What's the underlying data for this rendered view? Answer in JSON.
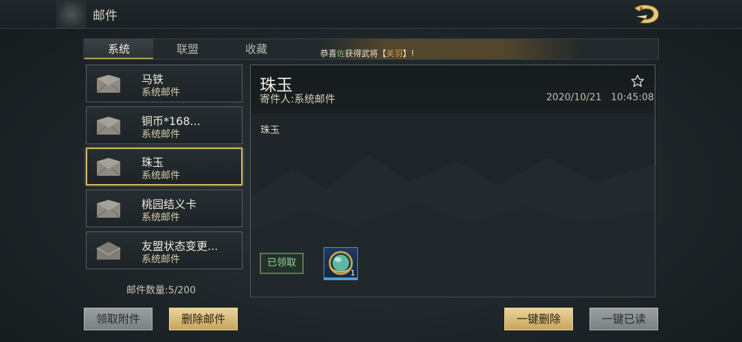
{
  "header": {
    "title": "邮件"
  },
  "tabs": [
    {
      "label": "系统"
    },
    {
      "label": "联盟"
    },
    {
      "label": "收藏"
    }
  ],
  "ticker": {
    "prefix": "恭喜",
    "player": "佐",
    "middle": "获得武将【",
    "hero": "关羽",
    "suffix": "】!"
  },
  "mails": [
    {
      "name": "马铁",
      "sender": "系统邮件",
      "opened": false
    },
    {
      "name": "铜币*168...",
      "sender": "系统邮件",
      "opened": false
    },
    {
      "name": "珠玉",
      "sender": "系统邮件",
      "opened": false
    },
    {
      "name": "桃园结义卡",
      "sender": "系统邮件",
      "opened": false
    },
    {
      "name": "友盟状态变更...",
      "sender": "系统邮件",
      "opened": true
    }
  ],
  "mail_count": "邮件数量:5/200",
  "detail": {
    "title": "珠玉",
    "from": "寄件人:系统邮件",
    "date": "2020/10/21",
    "time": "10:45:08",
    "body": "珠玉",
    "claimed_label": "已领取",
    "attachment_count": "1"
  },
  "buttons": {
    "claim_attachments": "领取附件",
    "delete_mail": "删除邮件",
    "delete_all": "一键删除",
    "read_all": "一键已读"
  },
  "colors": {
    "accent_gold": "#d5ba6c",
    "claimed_green": "#9fd39a",
    "ticker_green": "#6ec06e",
    "ticker_orange": "#e0a64a"
  }
}
